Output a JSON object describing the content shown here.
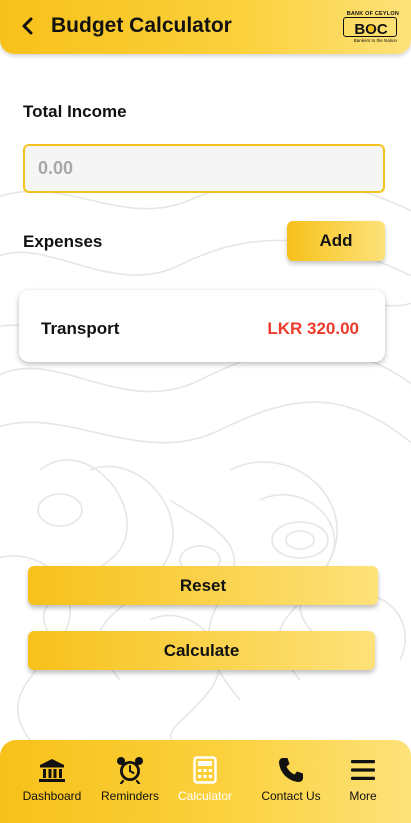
{
  "header": {
    "title": "Budget Calculator",
    "back_icon": "chevron-left-icon",
    "logo": {
      "top_text": "BANK OF CEYLON",
      "mark_text": "BOC",
      "sub_text": "Bankers to the Nation"
    }
  },
  "income": {
    "label": "Total Income",
    "value": "",
    "placeholder": "0.00"
  },
  "expenses": {
    "label": "Expenses",
    "add_label": "Add",
    "items": [
      {
        "name": "Transport",
        "amount": "LKR 320.00"
      }
    ]
  },
  "actions": {
    "reset_label": "Reset",
    "calculate_label": "Calculate"
  },
  "nav": {
    "items": [
      {
        "label": "Dashboard",
        "icon": "bank-icon",
        "active": false
      },
      {
        "label": "Reminders",
        "icon": "alarm-clock-icon",
        "active": false
      },
      {
        "label": "Calculator",
        "icon": "calculator-icon",
        "active": true
      },
      {
        "label": "Contact Us",
        "icon": "phone-icon",
        "active": false
      },
      {
        "label": "More",
        "icon": "menu-icon",
        "active": false
      }
    ]
  },
  "colors": {
    "accent": "#f7c11a",
    "accent_light": "#fde27a",
    "amount_red": "#ec3b2a",
    "active_nav_text": "#ffffff"
  }
}
